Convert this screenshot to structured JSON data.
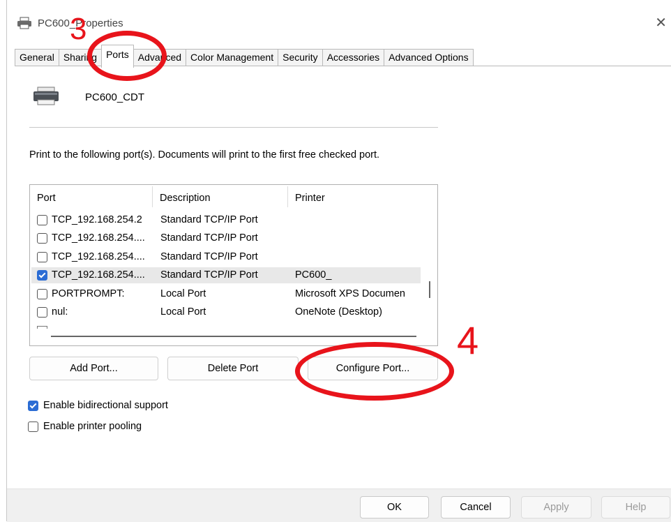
{
  "window": {
    "title": "PC600_Properties"
  },
  "tabs": [
    {
      "label": "General"
    },
    {
      "label": "Sharing"
    },
    {
      "label": "Ports"
    },
    {
      "label": "Advanced"
    },
    {
      "label": "Color Management"
    },
    {
      "label": "Security"
    },
    {
      "label": "Accessories"
    },
    {
      "label": "Advanced Options"
    }
  ],
  "printer": {
    "name": "PC600_CDT"
  },
  "instruction": "Print to the following port(s). Documents will print to the first free checked port.",
  "port_list": {
    "headers": {
      "port": "Port",
      "description": "Description",
      "printer": "Printer"
    },
    "rows": [
      {
        "port": "TCP_192.168.254.2",
        "description": "Standard TCP/IP Port",
        "printer": "",
        "checked": false
      },
      {
        "port": "TCP_192.168.254....",
        "description": "Standard TCP/IP Port",
        "printer": "",
        "checked": false
      },
      {
        "port": "TCP_192.168.254....",
        "description": "Standard TCP/IP Port",
        "printer": "",
        "checked": false
      },
      {
        "port": "TCP_192.168.254....",
        "description": "Standard TCP/IP Port",
        "printer": "PC600_",
        "checked": true
      },
      {
        "port": "PORTPROMPT:",
        "description": "Local Port",
        "printer": "Microsoft XPS Documen",
        "checked": false
      },
      {
        "port": "nul:",
        "description": "Local Port",
        "printer": "OneNote (Desktop)",
        "checked": false
      }
    ]
  },
  "buttons": {
    "add_port": "Add Port...",
    "delete_port": "Delete Port",
    "configure_port": "Configure Port..."
  },
  "options": {
    "bidirectional": {
      "label": "Enable bidirectional support",
      "checked": true
    },
    "pooling": {
      "label": "Enable printer pooling",
      "checked": false
    }
  },
  "dialog_buttons": {
    "ok": "OK",
    "cancel": "Cancel",
    "apply": "Apply",
    "help": "Help"
  },
  "annotations": {
    "step3": "3",
    "step4": "4",
    "color": "#e8141b"
  }
}
